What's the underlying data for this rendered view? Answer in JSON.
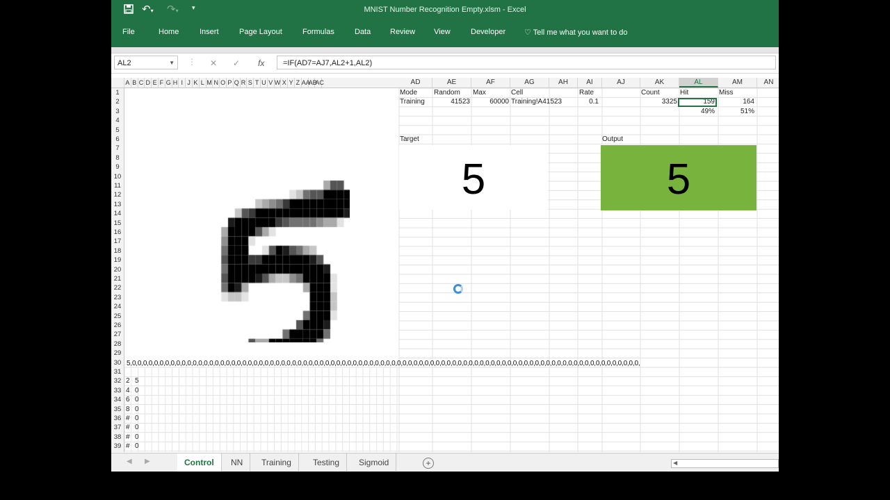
{
  "window": {
    "title": "MNIST Number Recognition Empty.xlsm  -  Excel"
  },
  "ribbon": {
    "tabs": [
      "File",
      "Home",
      "Insert",
      "Page Layout",
      "Formulas",
      "Data",
      "Review",
      "View",
      "Developer"
    ],
    "tell_me": "Tell me what you want to do"
  },
  "formula_bar": {
    "name_box": "AL2",
    "formula": "=IF(AD7=AJ7,AL2+1,AL2)"
  },
  "columns": {
    "narrow": [
      "A",
      "B",
      "C",
      "D",
      "E",
      "F",
      "G",
      "H",
      "I",
      "J",
      "K",
      "L",
      "M",
      "N",
      "O",
      "P",
      "Q",
      "R",
      "S",
      "T",
      "U",
      "V",
      "W",
      "X",
      "Y",
      "Z",
      "AA",
      "AB",
      "AC"
    ],
    "wide": [
      "AD",
      "AE",
      "AF",
      "AG",
      "AH",
      "AI",
      "AJ",
      "AK",
      "AL",
      "AM",
      "AN"
    ],
    "selected": "AL"
  },
  "rows": [
    "1",
    "2",
    "3",
    "4",
    "5",
    "6",
    "7",
    "8",
    "9",
    "10",
    "11",
    "12",
    "13",
    "14",
    "15",
    "16",
    "17",
    "18",
    "19",
    "20",
    "21",
    "22",
    "23",
    "24",
    "25",
    "26",
    "27",
    "28",
    "29",
    "30",
    "31",
    "32",
    "33",
    "34",
    "35",
    "36",
    "37",
    "38",
    "39"
  ],
  "cells": {
    "mode_label": "Mode",
    "mode_value": "Training",
    "random_label": "Random",
    "random_value": "41523",
    "max_label": "Max",
    "max_value": "60000",
    "cell_label": "Cell",
    "cell_value": "Training!A41523",
    "rate_label": "Rate",
    "rate_value": "0.1",
    "count_label": "Count",
    "count_value": "3325",
    "hit_label": "Hit",
    "hit_value": "159",
    "hit_pct": "49%",
    "miss_label": "Miss",
    "miss_value": "164",
    "miss_pct": "51%",
    "target_label": "Target",
    "target_digit": "5",
    "output_label": "Output",
    "output_digit": "5",
    "row30_text": "5,0,0,0,0,0,0,0,0,0,0,0,0,0,0,0,0,0,0,0,0,0,0,0,0,0,0,0,0,0,0,0,0,0,0,0,0,0,0,0,0,0,0,0,0,0,0,0,0,0,0,0,0,0,0,0,0,0,0,0,0,0,0,0,0,0,0,0,0,0,0,0,0,0,0,0,0,0,0,0,0,0,0,0,0,0,0,0,0,0,0,0,0,",
    "list": [
      [
        "2",
        "5"
      ],
      [
        "4",
        "0"
      ],
      [
        "6",
        "0"
      ],
      [
        "8",
        "0"
      ],
      [
        "#",
        "0"
      ],
      [
        "#",
        "0"
      ],
      [
        "#",
        "0"
      ],
      [
        "#",
        "0"
      ]
    ]
  },
  "digit_bitmap": [
    "0000000000000000000000000000",
    "0000000000000000000000000000",
    "0000000000000000000000000000",
    "0000000000000000000000000000",
    "0000000000000000000000000000",
    "0000000000000000000366000000",
    "0000000000000012566999920000",
    "0000000002345799999999999000",
    "0000002679999999999999863000",
    "0000089999997655554331000000",
    "0000399996310000000000000000",
    "0000499910000000000000000000",
    "0000599900169865320000000000",
    "0000699977999999986000000000",
    "0000599999999999999800000000",
    "0000699998632245999910000000",
    "0000598300000000399910000000",
    "0000122100000000099920000000",
    "0000000000000000099920000000",
    "0000000000000000599910000000",
    "0000000000000006999800000000",
    "0000000000000599999500000000",
    "0000000063399999995000000000",
    "0000000799999999750000000000",
    "0000000479999973000000000000",
    "0000000000000000000000000000",
    "0000000000000000000000000000",
    "0000000000000000000000000000"
  ],
  "sheets": {
    "tabs": [
      "Control",
      "NN",
      "Training",
      "Testing",
      "Sigmoid"
    ],
    "active": "Control"
  },
  "colors": {
    "excel_green": "#217346",
    "output_fill": "#78b33e"
  },
  "icons": [
    "save-icon",
    "undo-icon",
    "redo-icon",
    "customize-icon",
    "lightbulb-icon",
    "cancel-icon",
    "enter-icon",
    "function-icon",
    "add-sheet-icon"
  ]
}
